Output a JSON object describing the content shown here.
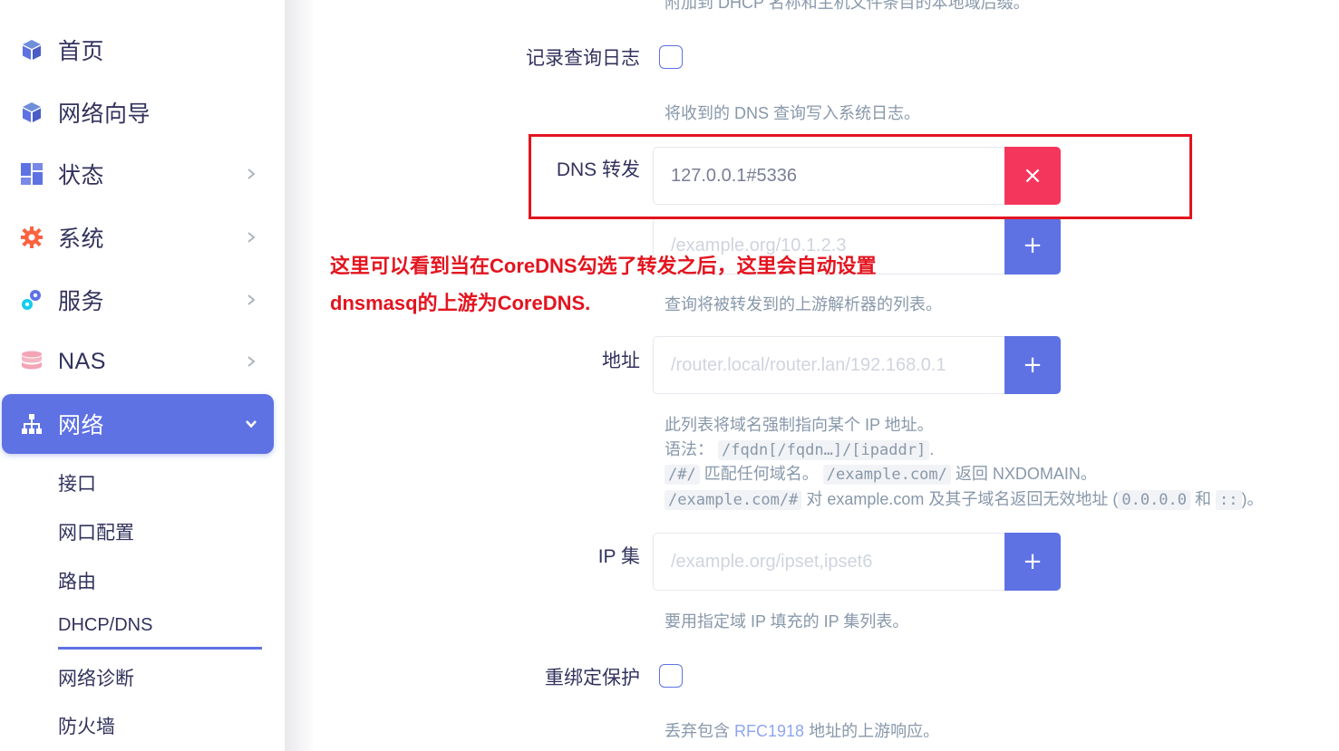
{
  "sidebar": {
    "items": [
      {
        "label": "首页",
        "icon": "cube-icon",
        "has_chevron": false
      },
      {
        "label": "网络向导",
        "icon": "cube-icon",
        "has_chevron": false
      },
      {
        "label": "状态",
        "icon": "dashboard-icon",
        "has_chevron": true
      },
      {
        "label": "系统",
        "icon": "gear-icon",
        "has_chevron": true
      },
      {
        "label": "服务",
        "icon": "gears-icon",
        "has_chevron": true
      },
      {
        "label": "NAS",
        "icon": "database-icon",
        "has_chevron": true
      },
      {
        "label": "网络",
        "icon": "sitemap-icon",
        "has_chevron": true,
        "active": true
      }
    ],
    "subitems": [
      "接口",
      "网口配置",
      "路由",
      "DHCP/DNS",
      "网络诊断",
      "防火墙"
    ],
    "active_subitem": "DHCP/DNS"
  },
  "form": {
    "top_cut_text": "附加到 DHCP 名称和主机文件条目的本地域后缀。",
    "log_queries": {
      "label": "记录查询日志",
      "checked": false,
      "desc": "将收到的 DNS 查询写入系统日志。"
    },
    "dns_forward": {
      "label": "DNS 转发",
      "value": "127.0.0.1#5336",
      "remove_label": "×",
      "placeholder": "/example.org/10.1.2.3",
      "add_label": "+",
      "desc": "查询将被转发到的上游解析器的列表。"
    },
    "address": {
      "label": "地址",
      "placeholder": "/router.local/router.lan/192.168.0.1",
      "add_label": "+",
      "desc_line1": "此列表将域名强制指向某个 IP 地址。",
      "syntax_label": "语法：",
      "syntax_code": "/fqdn[/fqdn…]/[ipaddr]",
      "line3_code1": "/#/",
      "line3_text1": "匹配任何域名。",
      "line3_code2": "/example.com/",
      "line3_text2": "返回 NXDOMAIN。",
      "line4_code1": "/example.com/#",
      "line4_text1": "对 example.com 及其子域名返回无效地址 (",
      "line4_code2": "0.0.0.0",
      "line4_text2": "和",
      "line4_code3": "::",
      "line4_text3": ")。"
    },
    "ipset": {
      "label": "IP 集",
      "placeholder": "/example.org/ipset,ipset6",
      "add_label": "+",
      "desc": "要用指定域 IP 填充的 IP 集列表。"
    },
    "rebind_protection": {
      "label": "重绑定保护",
      "checked": false,
      "desc_prefix": "丢弃包含",
      "desc_link": "RFC1918",
      "desc_suffix": "地址的上游响应。"
    }
  },
  "annotation": {
    "line1": "这里可以看到当在CoreDNS勾选了转发之后，这里会自动设置",
    "line2": "dnsmasq的上游为CoreDNS.",
    "color": "#e3141f"
  },
  "colors": {
    "accent": "#5e72e4",
    "danger": "#f5365c",
    "text": "#32325d",
    "muted": "#8898aa"
  }
}
